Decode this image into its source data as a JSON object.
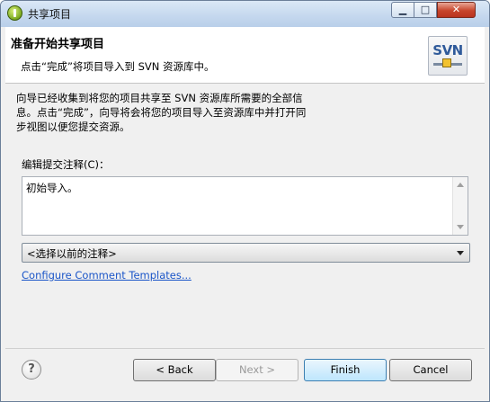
{
  "window": {
    "title": "共享项目",
    "min_glyph": "▁",
    "max_glyph": "□",
    "close_glyph": "✕"
  },
  "header": {
    "title": "准备开始共享项目",
    "description": "点击“完成”将项目导入到 SVN 资源库中。",
    "logo_text": "SVN"
  },
  "intro": {
    "lines": [
      "向导已经收集到将您的项目共享至 SVN 资源库所需要的全部信",
      "息。点击“完成”，向导将会将您的项目导入至资源库中并打开同",
      "步视图以便您提交资源。"
    ]
  },
  "comment": {
    "label": "编辑提交注释(C)：",
    "value": "初始导入。"
  },
  "previous_comments": {
    "selected": "<选择以前的注释>"
  },
  "templates_link": "Configure Comment Templates...",
  "buttons": {
    "help": "?",
    "back": "< Back",
    "next": "Next >",
    "finish": "Finish",
    "cancel": "Cancel"
  },
  "icons": [
    "app-icon",
    "svn-logo-icon",
    "help-icon",
    "scroll-up-icon",
    "scroll-down-icon",
    "dropdown-arrow-icon"
  ]
}
